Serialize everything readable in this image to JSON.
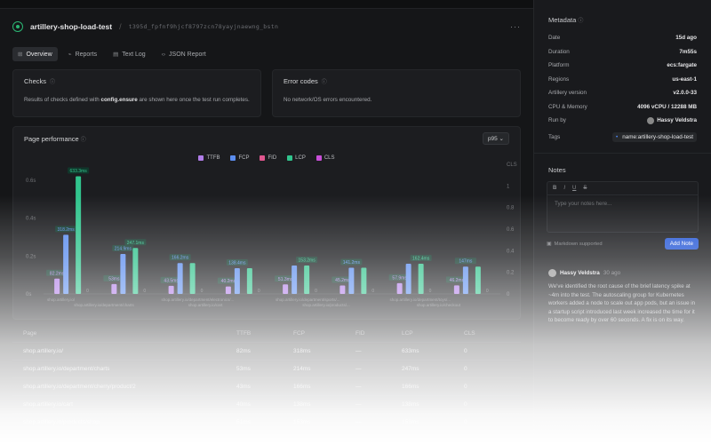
{
  "header": {
    "title": "artillery-shop-load-test",
    "run_id": "t395d_fpfnf9hjcf8797zcn78yayjnaewng_bstn"
  },
  "tabs": [
    {
      "label": "Overview",
      "icon": "grid-icon"
    },
    {
      "label": "Reports",
      "icon": "chart-icon"
    },
    {
      "label": "Text Log",
      "icon": "document-icon"
    },
    {
      "label": "JSON Report",
      "icon": "code-icon"
    }
  ],
  "checks": {
    "title": "Checks",
    "text_before": "Results of checks defined with ",
    "code": "config.ensure",
    "text_after": " are shown here once the test run completes."
  },
  "errors": {
    "title": "Error codes",
    "text": "No network/OS errors encountered."
  },
  "perf": {
    "title": "Page performance",
    "percentile": "p95"
  },
  "chart_data": {
    "type": "bar",
    "legend": [
      "TTFB",
      "FCP",
      "FID",
      "LCP",
      "CLS"
    ],
    "colors": {
      "TTFB": "#b07ce8",
      "FCP": "#5b8def",
      "FID": "#e0568e",
      "LCP": "#31c48d",
      "CLS": "#c84fd8"
    },
    "ylabels_left": [
      "0.6s",
      "0.4s",
      "0.2s",
      "0s"
    ],
    "ylabels_right": [
      "CLS",
      "1",
      "0.8",
      "0.6",
      "0.4",
      "0.2",
      "0"
    ],
    "y_left_range": [
      0,
      0.65
    ],
    "groups": [
      {
        "ttfb": 82.2,
        "fcp": 318.2,
        "lcp": 633.3,
        "cls": 0,
        "labels": {
          "ttfb": "82.2ms",
          "fcp": "318.2ms",
          "lcp": "633.3ms",
          "cls": "0"
        }
      },
      {
        "ttfb": 53,
        "fcp": 214.9,
        "lcp": 247.1,
        "cls": 0,
        "labels": {
          "ttfb": "53ms",
          "fcp": "214.9ms",
          "lcp": "247.1ms",
          "cls": "0"
        }
      },
      {
        "ttfb": 43.5,
        "fcp": 166.2,
        "lcp": 166.2,
        "cls": 0,
        "labels": {
          "ttfb": "43.5ms",
          "fcp": "166.2ms",
          "lcp": "",
          "cls": "0"
        }
      },
      {
        "ttfb": 40.2,
        "fcp": 138.4,
        "lcp": 138.4,
        "cls": 0,
        "labels": {
          "ttfb": "40.2ms",
          "fcp": "138.4ms",
          "lcp": "",
          "cls": "0"
        }
      },
      {
        "ttfb": 51.3,
        "fcp": 153.2,
        "lcp": 153.2,
        "cls": 0,
        "labels": {
          "ttfb": "51.3ms",
          "fcp": "",
          "lcp": "153.2ms",
          "cls": "0"
        }
      },
      {
        "ttfb": 45.2,
        "fcp": 141.2,
        "lcp": 141.2,
        "cls": 0,
        "labels": {
          "ttfb": "45.2ms",
          "fcp": "141.2ms",
          "lcp": "",
          "cls": "0"
        }
      },
      {
        "ttfb": 57.9,
        "fcp": 162.4,
        "lcp": 162.4,
        "cls": 0,
        "labels": {
          "ttfb": "57.9ms",
          "fcp": "",
          "lcp": "162.4ms",
          "cls": "0"
        }
      },
      {
        "ttfb": 46.2,
        "fcp": 147,
        "lcp": 147,
        "cls": 0,
        "labels": {
          "ttfb": "46.2ms",
          "fcp": "147ms",
          "lcp": "",
          "cls": "0"
        }
      }
    ],
    "xlabels_row1": [
      "shop.artillery.io/",
      "shop.artillery.io/department/electronics/...",
      "shop.artillery.io/department/sports/...",
      "shop.artillery.io/department/toys/..."
    ],
    "xlabels_row2": [
      "shop.artillery.io/department/charts",
      "shop.artillery.io/cart",
      "shop.artillery.io/products/...",
      "shop.artillery.io/checkout"
    ]
  },
  "table": {
    "headers": [
      "Page",
      "TTFB",
      "FCP",
      "FID",
      "LCP",
      "CLS"
    ],
    "rows": [
      [
        "shop.artillery.io/",
        "82ms",
        "318ms",
        "—",
        "633ms",
        "0"
      ],
      [
        "shop.artillery.io/department/charts",
        "53ms",
        "214ms",
        "—",
        "247ms",
        "0"
      ],
      [
        "shop.artillery.io/department/cherry/product/2",
        "43ms",
        "166ms",
        "—",
        "166ms",
        "0"
      ],
      [
        "shop.artillery.io/cart",
        "40ms",
        "138ms",
        "—",
        "138ms",
        "0"
      ],
      [
        "shop.artillery.io/products/shop",
        "51ms",
        "153ms",
        "—",
        "153ms",
        "0"
      ]
    ]
  },
  "metadata": {
    "title": "Metadata",
    "rows": [
      {
        "key": "Date",
        "value": "15d ago"
      },
      {
        "key": "Duration",
        "value": "7m55s"
      },
      {
        "key": "Platform",
        "value": "ecs:fargate"
      },
      {
        "key": "Regions",
        "value": "us-east-1"
      },
      {
        "key": "Artillery version",
        "value": "v2.0.0-33"
      },
      {
        "key": "CPU & Memory",
        "value": "4096 vCPU / 12288 MB"
      },
      {
        "key": "Run by",
        "value": "Hassy Veldstra"
      },
      {
        "key": "Tags",
        "value": "name:artillery-shop-load-test"
      }
    ]
  },
  "notes": {
    "title": "Notes",
    "toolbar": [
      "B",
      "I",
      "U",
      "S"
    ],
    "placeholder": "Type your notes here...",
    "markdown_label": "Markdown supported",
    "add_label": "Add Note",
    "author": "Hassy Veldstra",
    "ago": "30 ago",
    "body": "We've identified the root cause of the brief latency spike at ~4m into the test. The autoscaling group for Kubernetes workers added a node to scale out app pods, but an issue in a startup script introduced last week increased the time for it to become ready by over 60 seconds. A fix is on its way."
  }
}
